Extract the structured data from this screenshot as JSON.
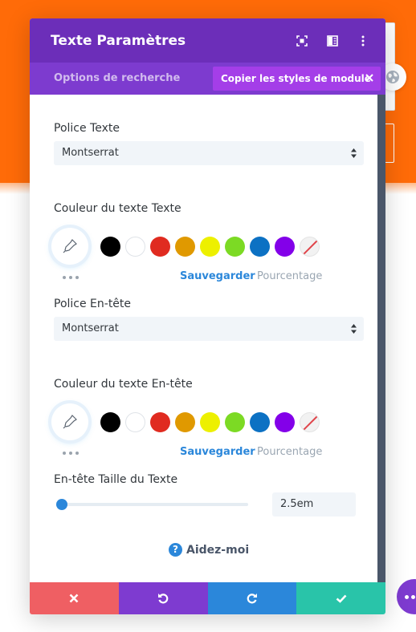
{
  "modal": {
    "title": "Texte Paramètres",
    "tab_search": "Options de recherche",
    "copy_styles": "Copier les styles de module"
  },
  "sections": {
    "text_font_label": "Police Texte",
    "text_font_value": "Montserrat",
    "text_color_label": "Couleur du texte Texte",
    "header_font_label": "Police En-tête",
    "header_font_value": "Montserrat",
    "header_color_label": "Couleur du texte En-tête",
    "header_size_label": "En-tête Taille du Texte",
    "header_size_value": "2.5em",
    "header_size_slider_fraction": 0.0
  },
  "palette": {
    "save_label": "Sauvegarder",
    "percent_label": "Pourcentage",
    "swatches": [
      "#000000",
      "#ffffff",
      "#e02b20",
      "#e09900",
      "#edf000",
      "#7cda24",
      "#0c71c3",
      "#8300e9",
      "none"
    ]
  },
  "help": {
    "label": "Aidez-moi"
  },
  "colors": {
    "header": "#6c2eb9",
    "tabs": "#7d3bcf",
    "copy_pill": "#a43ee8",
    "accent": "#2b87da",
    "cancel": "#ef5f63",
    "undo": "#7e3bd0",
    "redo": "#2b87da",
    "save": "#29c4a9",
    "background_orange": "#ff6b08"
  },
  "icons": {
    "header": [
      "fullscreen-icon",
      "split-view-icon",
      "more-vertical-icon"
    ],
    "footer": [
      "close-icon",
      "undo-icon",
      "redo-icon",
      "check-icon"
    ]
  }
}
